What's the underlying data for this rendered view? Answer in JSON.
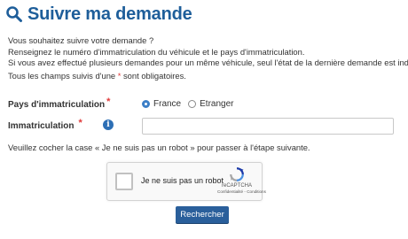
{
  "header": {
    "title": "Suivre ma demande",
    "icon": "search-icon",
    "title_color": "#1e5e9a"
  },
  "intro": {
    "line1": "Vous souhaitez suivre votre demande ?",
    "line2": "Renseignez le numéro d'immatriculation du véhicule et le pays d'immatriculation.",
    "line3": "Si vous avez effectué plusieurs demandes pour un même véhicule, seul l'état de la dernière demande est indiqué."
  },
  "mandatory": {
    "before": "Tous les champs suivis d'une ",
    "star": "*",
    "after": " sont obligatoires."
  },
  "form": {
    "country": {
      "label": "Pays d'immatriculation",
      "required_mark": "*",
      "options": [
        {
          "label": "France",
          "selected": true
        },
        {
          "label": "Etranger",
          "selected": false
        }
      ]
    },
    "plate": {
      "label": "Immatriculation",
      "required_mark": "*",
      "info_icon": "info-icon",
      "info_glyph": "i",
      "value": "",
      "placeholder": ""
    }
  },
  "robot_note": "Veuillez cocher la case « Je ne suis pas un robot » pour passer à l'étape suivante.",
  "captcha": {
    "label": "Je ne suis pas un robot",
    "brand": "reCAPTCHA",
    "terms": "Confidentialité - Conditions",
    "checked": false
  },
  "submit": {
    "label": "Rechercher",
    "color": "#2a5f9b"
  },
  "colors": {
    "required": "#e03a3a",
    "accent": "#3c7fc7"
  }
}
